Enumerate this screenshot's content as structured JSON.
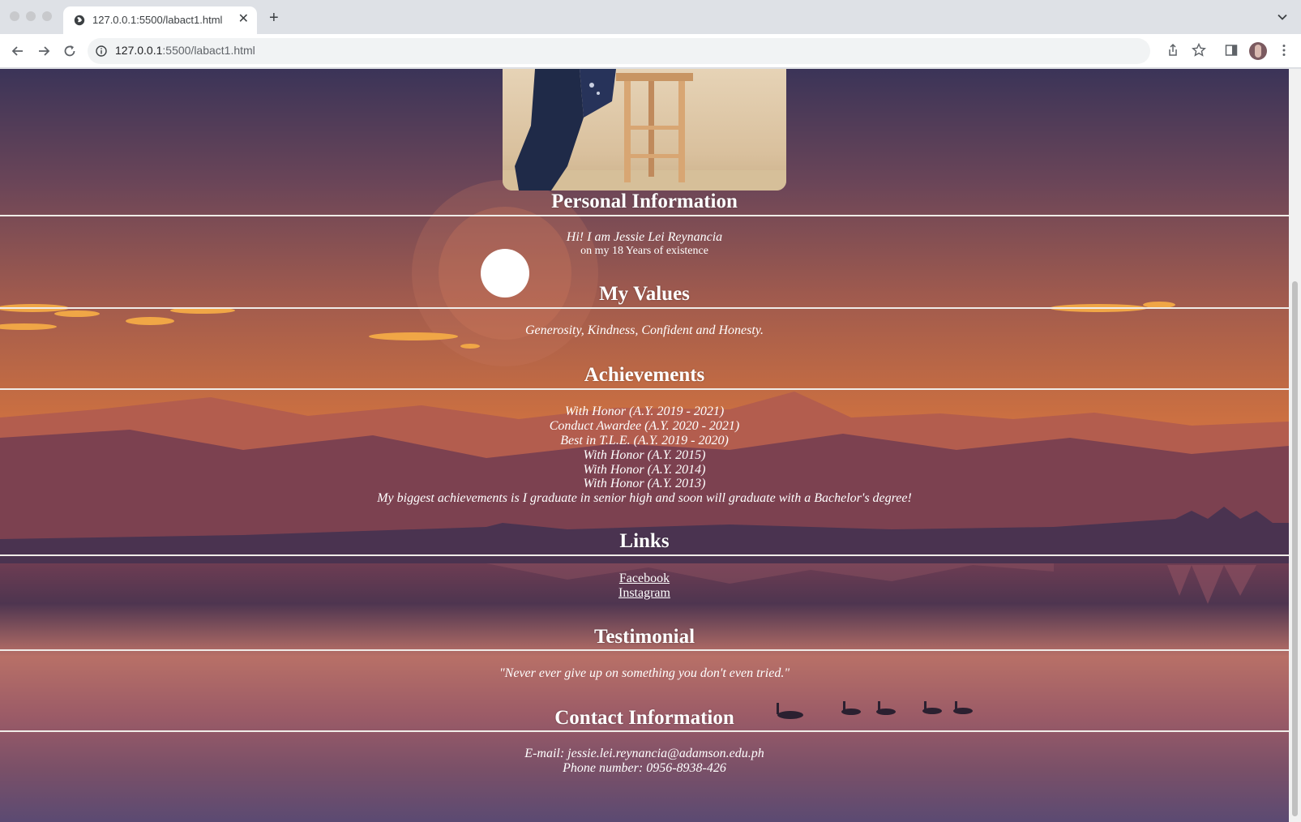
{
  "browser": {
    "tab_title": "127.0.0.1:5500/labact1.html",
    "url_host": "127.0.0.1",
    "url_rest": ":5500/labact1.html"
  },
  "page": {
    "personal": {
      "heading": "Personal Information",
      "line1": "Hi! I am Jessie Lei Reynancia",
      "line2": "on my 18 Years of existence"
    },
    "values": {
      "heading": "My Values",
      "text": "Generosity, Kindness, Confident and Honesty."
    },
    "achievements": {
      "heading": "Achievements",
      "items": [
        "With Honor (A.Y. 2019 - 2021)",
        "Conduct Awardee (A.Y. 2020 - 2021)",
        "Best in T.L.E. (A.Y. 2019 - 2020)",
        "With Honor (A.Y. 2015)",
        "With Honor (A.Y. 2014)",
        "With Honor (A.Y. 2013)",
        "My biggest achievements is I graduate in senior high and soon will graduate with a Bachelor's degree!"
      ]
    },
    "links": {
      "heading": "Links",
      "facebook": "Facebook",
      "instagram": "Instagram"
    },
    "testimonial": {
      "heading": "Testimonial",
      "quote": "\"Never ever give up on something you don't even tried.\""
    },
    "contact": {
      "heading": "Contact Information",
      "email": "E-mail: jessie.lei.reynancia@adamson.edu.ph",
      "phone": "Phone number: 0956-8938-426"
    }
  }
}
